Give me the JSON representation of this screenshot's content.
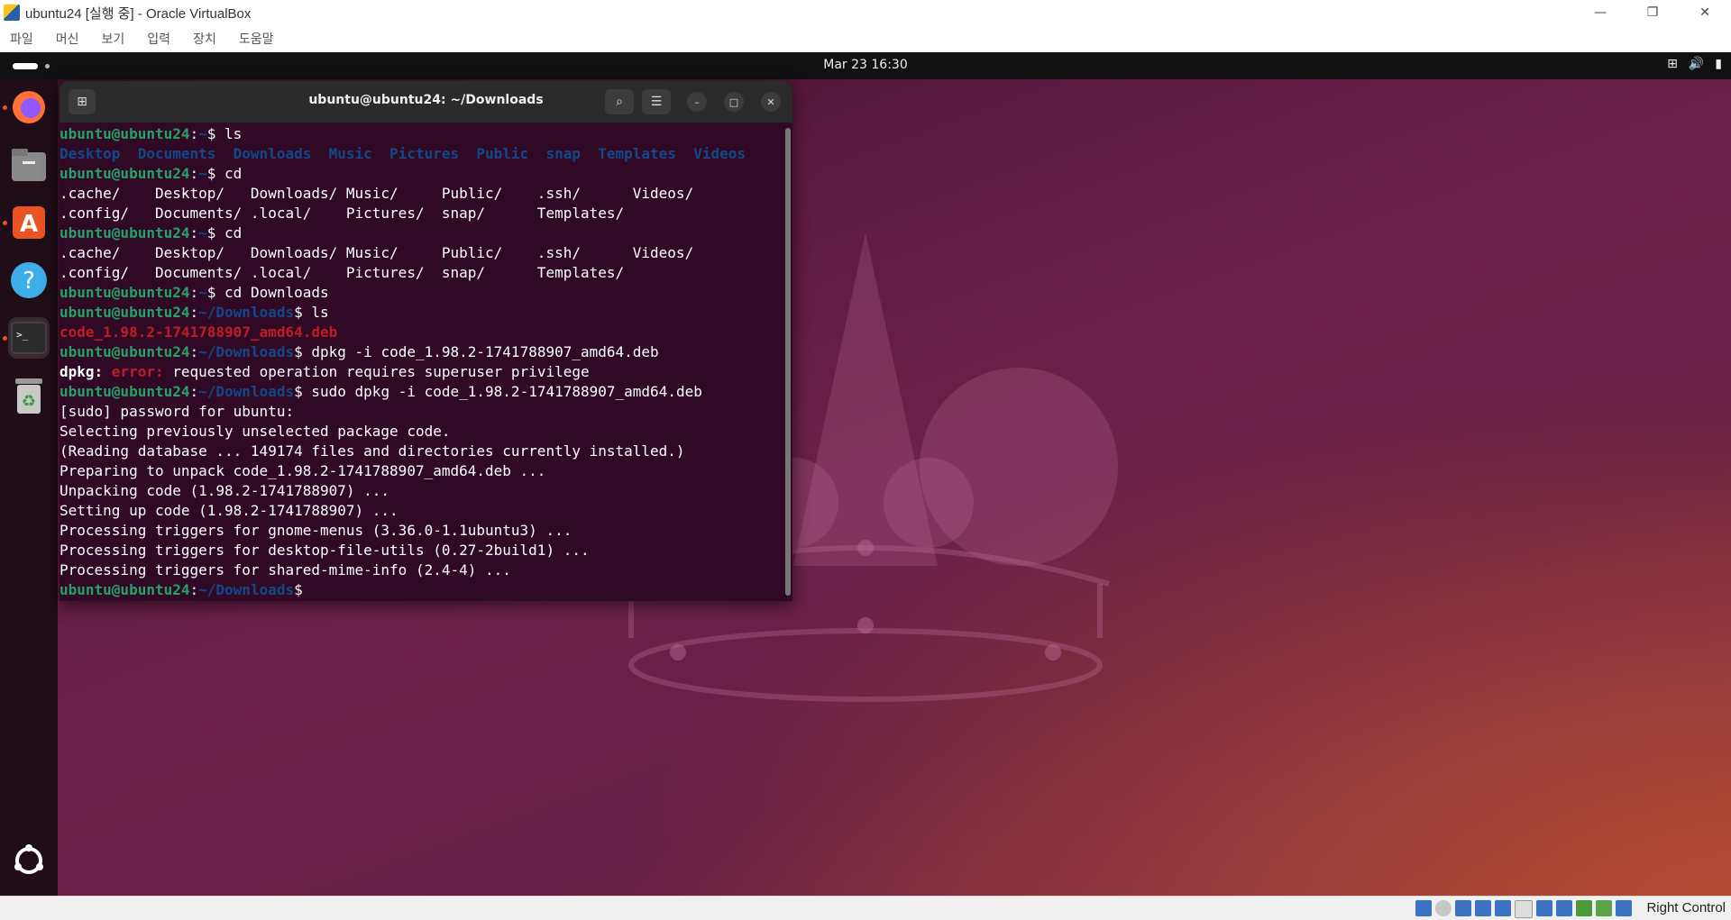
{
  "host": {
    "title": "ubuntu24 [실행 중] - Oracle VirtualBox",
    "menu": [
      "파일",
      "머신",
      "보기",
      "입력",
      "장치",
      "도움말"
    ],
    "host_key": "Right Control"
  },
  "guest": {
    "clock": "Mar 23  16:30"
  },
  "terminal": {
    "title": "ubuntu@ubuntu24: ~/Downloads",
    "lines": [
      [
        {
          "t": "ubuntu@ubuntu24",
          "c": "g"
        },
        {
          "t": ":",
          "c": ""
        },
        {
          "t": "~",
          "c": "b"
        },
        {
          "t": "$ ls",
          "c": ""
        }
      ],
      [
        {
          "t": "Desktop  Documents  Downloads  Music  Pictures  Public  snap  Templates  Videos",
          "c": "b"
        }
      ],
      [
        {
          "t": "ubuntu@ubuntu24",
          "c": "g"
        },
        {
          "t": ":",
          "c": ""
        },
        {
          "t": "~",
          "c": "b"
        },
        {
          "t": "$ cd",
          "c": ""
        }
      ],
      [
        {
          "t": ".cache/    Desktop/   Downloads/ Music/     Public/    .ssh/      Videos/",
          "c": ""
        }
      ],
      [
        {
          "t": ".config/   Documents/ .local/    Pictures/  snap/      Templates/",
          "c": ""
        }
      ],
      [
        {
          "t": "ubuntu@ubuntu24",
          "c": "g"
        },
        {
          "t": ":",
          "c": ""
        },
        {
          "t": "~",
          "c": "b"
        },
        {
          "t": "$ cd",
          "c": ""
        }
      ],
      [
        {
          "t": ".cache/    Desktop/   Downloads/ Music/     Public/    .ssh/      Videos/",
          "c": ""
        }
      ],
      [
        {
          "t": ".config/   Documents/ .local/    Pictures/  snap/      Templates/",
          "c": ""
        }
      ],
      [
        {
          "t": "ubuntu@ubuntu24",
          "c": "g"
        },
        {
          "t": ":",
          "c": ""
        },
        {
          "t": "~",
          "c": "b"
        },
        {
          "t": "$ cd Downloads",
          "c": ""
        }
      ],
      [
        {
          "t": "ubuntu@ubuntu24",
          "c": "g"
        },
        {
          "t": ":",
          "c": ""
        },
        {
          "t": "~/Downloads",
          "c": "b"
        },
        {
          "t": "$ ls",
          "c": ""
        }
      ],
      [
        {
          "t": "code_1.98.2-1741788907_amd64.deb",
          "c": "r"
        }
      ],
      [
        {
          "t": "ubuntu@ubuntu24",
          "c": "g"
        },
        {
          "t": ":",
          "c": ""
        },
        {
          "t": "~/Downloads",
          "c": "b"
        },
        {
          "t": "$ dpkg -i code_1.98.2-1741788907_amd64.deb",
          "c": ""
        }
      ],
      [
        {
          "t": "dpkg: ",
          "c": "w"
        },
        {
          "t": "error: ",
          "c": "r"
        },
        {
          "t": "requested operation requires superuser privilege",
          "c": ""
        }
      ],
      [
        {
          "t": "ubuntu@ubuntu24",
          "c": "g"
        },
        {
          "t": ":",
          "c": ""
        },
        {
          "t": "~/Downloads",
          "c": "b"
        },
        {
          "t": "$ sudo dpkg -i code_1.98.2-1741788907_amd64.deb",
          "c": ""
        }
      ],
      [
        {
          "t": "[sudo] password for ubuntu:",
          "c": ""
        }
      ],
      [
        {
          "t": "Selecting previously unselected package code.",
          "c": ""
        }
      ],
      [
        {
          "t": "(Reading database ... 149174 files and directories currently installed.)",
          "c": ""
        }
      ],
      [
        {
          "t": "Preparing to unpack code_1.98.2-1741788907_amd64.deb ...",
          "c": ""
        }
      ],
      [
        {
          "t": "Unpacking code (1.98.2-1741788907) ...",
          "c": ""
        }
      ],
      [
        {
          "t": "Setting up code (1.98.2-1741788907) ...",
          "c": ""
        }
      ],
      [
        {
          "t": "Processing triggers for gnome-menus (3.36.0-1.1ubuntu3) ...",
          "c": ""
        }
      ],
      [
        {
          "t": "Processing triggers for desktop-file-utils (0.27-2build1) ...",
          "c": ""
        }
      ],
      [
        {
          "t": "Processing triggers for shared-mime-info (2.4-4) ...",
          "c": ""
        }
      ],
      [
        {
          "t": "ubuntu@ubuntu24",
          "c": "g"
        },
        {
          "t": ":",
          "c": ""
        },
        {
          "t": "~/Downloads",
          "c": "b"
        },
        {
          "t": "$ ",
          "c": ""
        }
      ]
    ]
  },
  "dock": [
    {
      "name": "firefox-icon",
      "glyph": "🦊",
      "running": true
    },
    {
      "name": "files-icon",
      "glyph": "▬",
      "running": false
    },
    {
      "name": "app-center-icon",
      "glyph": "A",
      "running": true
    },
    {
      "name": "help-icon",
      "glyph": "?",
      "running": false
    },
    {
      "name": "terminal-icon",
      "glyph": ">_",
      "running": true
    },
    {
      "name": "trash-icon",
      "glyph": "♻",
      "running": false
    }
  ]
}
